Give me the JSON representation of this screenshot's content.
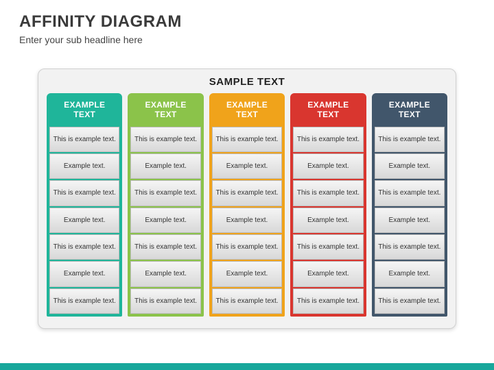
{
  "header": {
    "title": "AFFINITY DIAGRAM",
    "subtitle": "Enter your sub headline here"
  },
  "panel": {
    "title": "SAMPLE TEXT"
  },
  "columns": [
    {
      "color": "#1fb59a",
      "header": "EXAMPLE\nTEXT",
      "cells": [
        "This is example text.",
        "Example text.",
        "This is example text.",
        "Example text.",
        "This is example text.",
        "Example text.",
        "This is example text."
      ]
    },
    {
      "color": "#8bc34a",
      "header": "EXAMPLE\nTEXT",
      "cells": [
        "This is example text.",
        "Example text.",
        "This is example text.",
        "Example text.",
        "This is example text.",
        "Example text.",
        "This is example text."
      ]
    },
    {
      "color": "#f0a31b",
      "header": "EXAMPLE\nTEXT",
      "cells": [
        "This is example text.",
        "Example text.",
        "This is example text.",
        "Example text.",
        "This is example text.",
        "Example text.",
        "This is example text."
      ]
    },
    {
      "color": "#d9362f",
      "header": "EXAMPLE\nTEXT",
      "cells": [
        "This is example text.",
        "Example text.",
        "This is example text.",
        "Example text.",
        "This is example text.",
        "Example text.",
        "This is example text."
      ]
    },
    {
      "color": "#41566b",
      "header": "EXAMPLE\nTEXT",
      "cells": [
        "This is example text.",
        "Example text.",
        "This is example text.",
        "Example text.",
        "This is example text.",
        "Example text.",
        "This is example text."
      ]
    }
  ]
}
